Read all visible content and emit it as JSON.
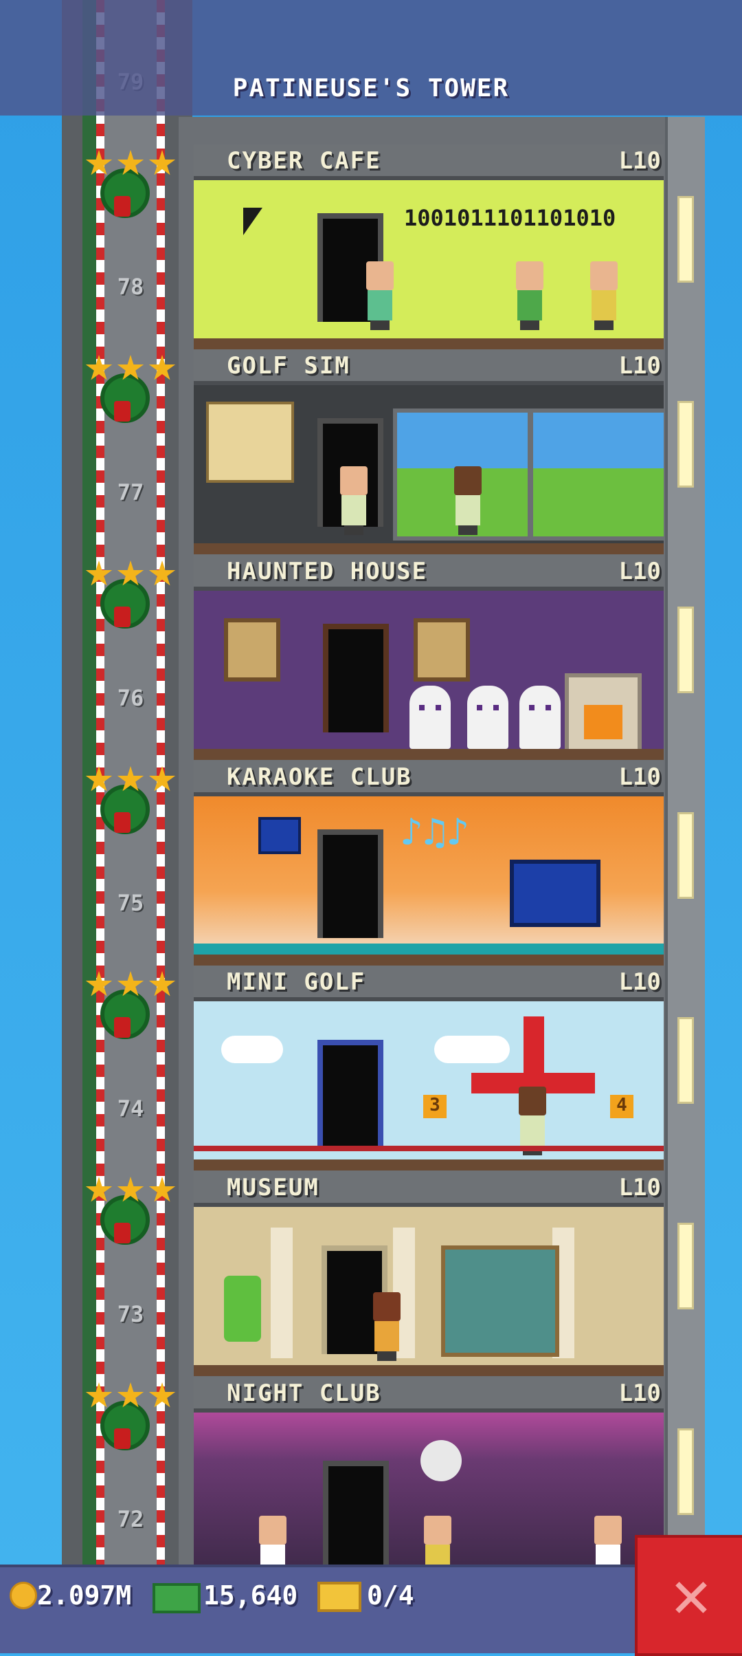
{
  "header": {
    "title": "PATINEUSE'S TOWER"
  },
  "elevator": {
    "floor_numbers": [
      "79",
      "78",
      "77",
      "76",
      "75",
      "74",
      "73",
      "72"
    ]
  },
  "floors": [
    {
      "name": "CYBER CAFE",
      "level": "L10",
      "screen_text": "1001011101101010"
    },
    {
      "name": "GOLF SIM",
      "level": "L10"
    },
    {
      "name": "HAUNTED HOUSE",
      "level": "L10"
    },
    {
      "name": "KARAOKE CLUB",
      "level": "L10"
    },
    {
      "name": "MINI GOLF",
      "level": "L10",
      "hole_numbers": [
        "3",
        "4"
      ]
    },
    {
      "name": "MUSEUM",
      "level": "L10"
    },
    {
      "name": "NIGHT CLUB",
      "level": "L10"
    }
  ],
  "footer": {
    "coins": "2.097M",
    "bux": "15,640",
    "tickets": "0/4"
  },
  "colors": {
    "sky": "#3aaef0",
    "cyber_cafe_wall": "#d4ec5a",
    "golf_sim_wall": "#3c3f42",
    "haunted_wall": "#5c3c7a",
    "karaoke_wall": "#f08a2c",
    "mini_golf_wall": "#bfe4f2",
    "museum_wall": "#d8c79a",
    "night_club_wall": "#6a3a72",
    "close_button": "#d8262c"
  },
  "icons": {
    "coin": "coin-icon",
    "bux": "cash-icon",
    "ticket": "ticket-icon",
    "close": "close-icon",
    "elevator_star": "star-icon",
    "elevator_wreath": "wreath-icon"
  }
}
